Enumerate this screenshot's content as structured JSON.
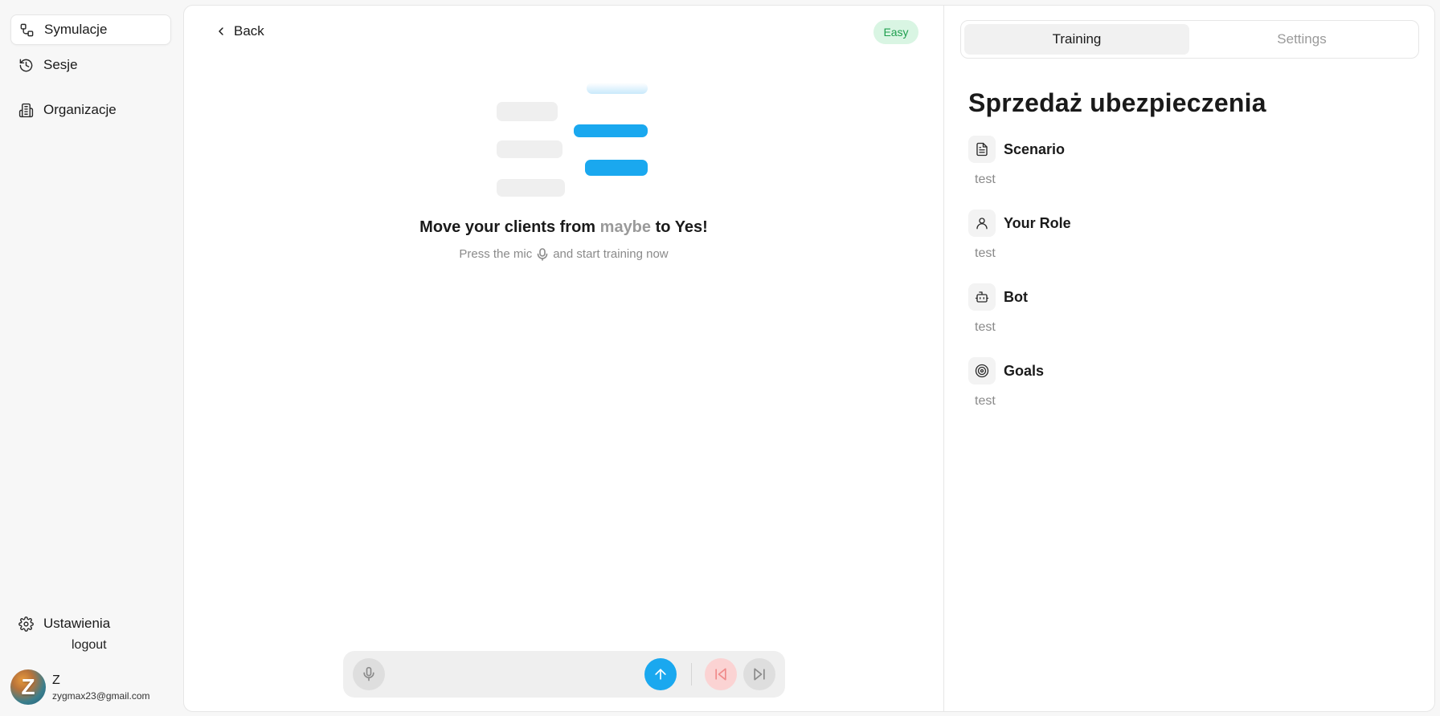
{
  "sidebar": {
    "items": [
      {
        "label": "Symulacje",
        "icon": "workflow-icon",
        "active": true
      },
      {
        "label": "Sesje",
        "icon": "history-icon",
        "active": false
      },
      {
        "label": "Organizacje",
        "icon": "building-icon",
        "active": false
      }
    ],
    "settings_label": "Ustawienia",
    "logout_label": "logout",
    "user": {
      "avatar_initial": "Z",
      "name": "Z",
      "email": "zygmax23@gmail.com"
    }
  },
  "main": {
    "back_label": "Back",
    "difficulty_badge": "Easy",
    "hero": {
      "title_part1": "Move your clients from",
      "title_muted": "maybe",
      "title_part2": "to",
      "title_bold": "Yes!",
      "subtitle_before": "Press the mic",
      "subtitle_after": "and start training now"
    },
    "composer": {
      "mic_icon": "mic-icon",
      "send_icon": "arrow-up-icon",
      "prev_icon": "skip-back-icon",
      "next_icon": "skip-forward-icon"
    }
  },
  "right_panel": {
    "tabs": [
      {
        "label": "Training",
        "active": true
      },
      {
        "label": "Settings",
        "active": false
      }
    ],
    "title": "Sprzedaż ubezpieczenia",
    "sections": [
      {
        "label": "Scenario",
        "icon": "document-icon",
        "value": "test"
      },
      {
        "label": "Your Role",
        "icon": "user-icon",
        "value": "test"
      },
      {
        "label": "Bot",
        "icon": "bot-icon",
        "value": "test"
      },
      {
        "label": "Goals",
        "icon": "target-icon",
        "value": "test"
      }
    ]
  },
  "colors": {
    "accent": "#1aa8ef",
    "badge_bg": "#d9f5e3",
    "badge_text": "#1e9e4e"
  }
}
